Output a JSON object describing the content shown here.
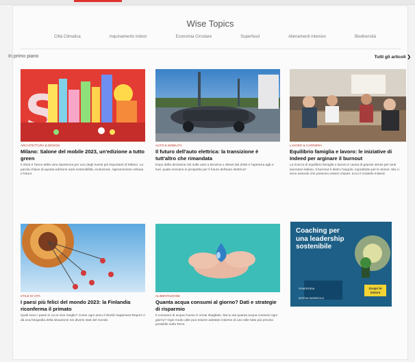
{
  "header": {
    "title": "Wise Topics"
  },
  "topics": [
    "Città Climatica",
    "Inquinamento indoor",
    "Economia Circolare",
    "Superfood",
    "Allenamenti intensivi",
    "Biodiversità"
  ],
  "section": {
    "title": "In primo piano",
    "see_all": "Tutti gli articoli"
  },
  "cards": [
    {
      "category": "Architettura & design",
      "title": "Milano: Salone del mobile 2023, un'edizione a tutto green",
      "excerpt": "Il 2023 è l'anno della vera ripartenza per uno degli eventi più importanti di Milano. La parola chiave di questa edizione sarà sostenibilità, evoluzione, rigenerazione urbana e futuro."
    },
    {
      "category": "Auto & mobilità",
      "title": "Il futuro dell'auto elettrica: la transizione è tutt'altro che rimandata",
      "excerpt": "Dopo della decisione UE sulle auto a benzina e diesel dal 2035 e l'apertura agli e-fuel, quale scenario si prospetta per il futuro dell'auto elettrica?"
    },
    {
      "category": "Lavoro & carriera",
      "title": "Equilibrio famiglia e lavoro: le iniziative di Indeed per arginare il burnout",
      "excerpt": "La ricerca di equilibrio famiglia e lavoro è causa di grande stress per tanti lavoratori italiani. Il burnout è dietro l'angolo, soprattutto per le donne. Ma ci sono aziende che possono essere d'aiuto: ecco il modello Indeed."
    },
    {
      "category": "Stile di vita",
      "title": "I paesi più felici del mondo 2023: la Finlandia riconferma il primato",
      "excerpt": "Quali sono i paesi in cui si vive meglio? Come ogni anno il World Happiness Report ci dà una fotografia della situazione nei diversi stati del mondo."
    },
    {
      "category": "Alimentazione",
      "title": "Quanta acqua consumi al giorno? Dati e strategie di risparmio",
      "excerpt": "Il consumo di acqua l'uomo è ormai sbagliato. Ma tu sai quanta acqua consumi ogni giorno? Ogni modo utile può essere adottato insieme di uno stile fatto più preciso possibile sulla Terra."
    }
  ],
  "ad": {
    "headline": "Coaching per una leadership sostenibile",
    "cta": "Scopri le lezioni",
    "logo1": "SYNERGEIA",
    "logo2": "INTESA SANPAOLO"
  }
}
